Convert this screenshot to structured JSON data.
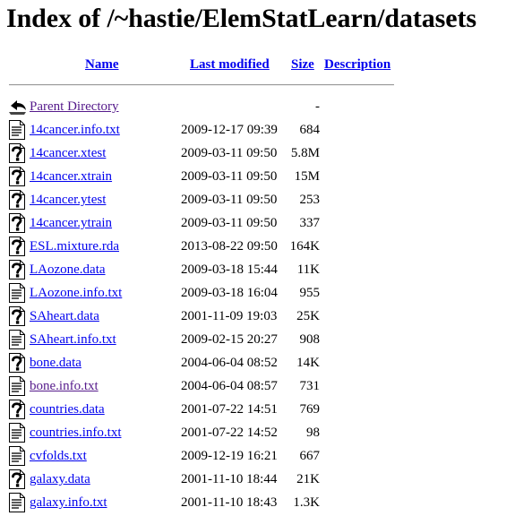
{
  "page": {
    "title": "Index of /~hastie/ElemStatLearn/datasets"
  },
  "columns": {
    "name": "Name",
    "last_modified": "Last modified",
    "size": "Size",
    "description": "Description"
  },
  "parent": {
    "label": "Parent Directory",
    "size": "-",
    "icon": "back-arrow-icon",
    "visited": true
  },
  "files": [
    {
      "name": "14cancer.info.txt",
      "modified": "2009-12-17 09:39",
      "size": "684",
      "icon": "text-file-icon",
      "visited": false
    },
    {
      "name": "14cancer.xtest",
      "modified": "2009-03-11 09:50",
      "size": "5.8M",
      "icon": "unknown-file-icon",
      "visited": false
    },
    {
      "name": "14cancer.xtrain",
      "modified": "2009-03-11 09:50",
      "size": "15M",
      "icon": "unknown-file-icon",
      "visited": false
    },
    {
      "name": "14cancer.ytest",
      "modified": "2009-03-11 09:50",
      "size": "253",
      "icon": "unknown-file-icon",
      "visited": false
    },
    {
      "name": "14cancer.ytrain",
      "modified": "2009-03-11 09:50",
      "size": "337",
      "icon": "unknown-file-icon",
      "visited": false
    },
    {
      "name": "ESL.mixture.rda",
      "modified": "2013-08-22 09:50",
      "size": "164K",
      "icon": "unknown-file-icon",
      "visited": false
    },
    {
      "name": "LAozone.data",
      "modified": "2009-03-18 15:44",
      "size": "11K",
      "icon": "unknown-file-icon",
      "visited": false
    },
    {
      "name": "LAozone.info.txt",
      "modified": "2009-03-18 16:04",
      "size": "955",
      "icon": "text-file-icon",
      "visited": false
    },
    {
      "name": "SAheart.data",
      "modified": "2001-11-09 19:03",
      "size": "25K",
      "icon": "unknown-file-icon",
      "visited": false
    },
    {
      "name": "SAheart.info.txt",
      "modified": "2009-02-15 20:27",
      "size": "908",
      "icon": "text-file-icon",
      "visited": false
    },
    {
      "name": "bone.data",
      "modified": "2004-06-04 08:52",
      "size": "14K",
      "icon": "unknown-file-icon",
      "visited": false
    },
    {
      "name": "bone.info.txt",
      "modified": "2004-06-04 08:57",
      "size": "731",
      "icon": "text-file-icon",
      "visited": true
    },
    {
      "name": "countries.data",
      "modified": "2001-07-22 14:51",
      "size": "769",
      "icon": "unknown-file-icon",
      "visited": false
    },
    {
      "name": "countries.info.txt",
      "modified": "2001-07-22 14:52",
      "size": "98",
      "icon": "text-file-icon",
      "visited": false
    },
    {
      "name": "cvfolds.txt",
      "modified": "2009-12-19 16:21",
      "size": "667",
      "icon": "text-file-icon",
      "visited": false
    },
    {
      "name": "galaxy.data",
      "modified": "2001-11-10 18:44",
      "size": "21K",
      "icon": "unknown-file-icon",
      "visited": false
    },
    {
      "name": "galaxy.info.txt",
      "modified": "2001-11-10 18:43",
      "size": "1.3K",
      "icon": "text-file-icon",
      "visited": false
    }
  ]
}
